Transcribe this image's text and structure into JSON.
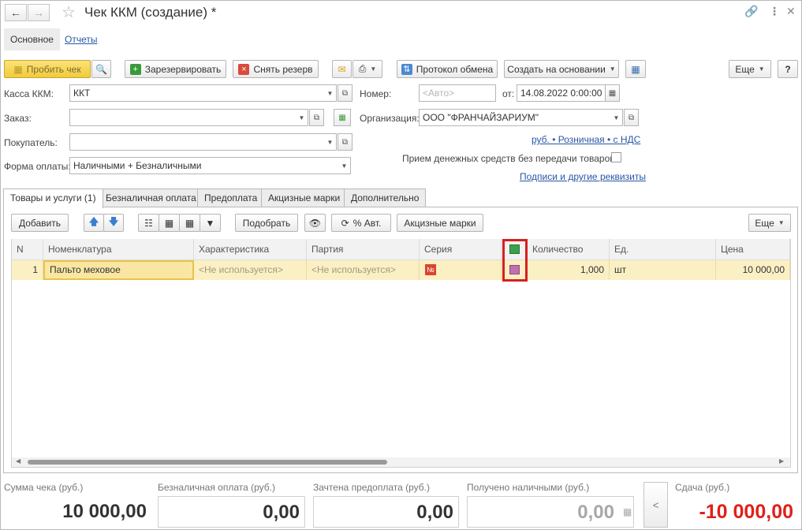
{
  "window": {
    "title": "Чек ККМ (создание) *"
  },
  "sections": {
    "main": "Основное",
    "reports": "Отчеты"
  },
  "toolbar": {
    "punch_receipt": "Пробить чек",
    "reserve": "Зарезервировать",
    "remove_reserve": "Снять резерв",
    "exchange_log": "Протокол обмена",
    "create_based_on": "Создать на основании",
    "more": "Еще",
    "help": "?"
  },
  "form": {
    "register_label": "Касса ККМ:",
    "register_value": "ККТ",
    "order_label": "Заказ:",
    "order_value": "",
    "buyer_label": "Покупатель:",
    "buyer_value": "",
    "payment_label": "Форма оплаты:",
    "payment_value": "Наличными + Безналичными",
    "number_label": "Номер:",
    "number_placeholder": "<Авто>",
    "date_label": "от:",
    "date_value": "14.08.2022  0:00:00",
    "org_label": "Организация:",
    "org_value": "ООО \"ФРАНЧАЙЗАРИУМ\"",
    "price_link": "руб. • Розничная • с НДС",
    "no_goods_label": "Прием денежных средств без передачи товаров:",
    "signatures_link": "Подписи и другие реквизиты"
  },
  "doc_tabs": [
    "Товары и услуги (1)",
    "Безналичная оплата",
    "Предоплата",
    "Акцизные марки",
    "Дополнительно"
  ],
  "table_toolbar": {
    "add": "Добавить",
    "pick": "Подобрать",
    "auto_percent": "% Авт.",
    "excise": "Акцизные марки",
    "more": "Еще"
  },
  "table": {
    "headers": [
      "N",
      "Номенклатура",
      "Характеристика",
      "Партия",
      "Серия",
      "",
      "Количество",
      "Ед.",
      "Цена"
    ],
    "rows": [
      {
        "n": "1",
        "item": "Пальто меховое",
        "characteristic": "<Не используется>",
        "batch": "<Не используется>",
        "series": "№",
        "quantity": "1,000",
        "unit": "шт",
        "price": "10 000,00"
      }
    ]
  },
  "footer": {
    "sum_label": "Сумма чека (руб.)",
    "sum_value": "10 000,00",
    "card_label": "Безналичная оплата (руб.)",
    "card_value": "0,00",
    "prepay_label": "Зачтена предоплата (руб.)",
    "prepay_value": "0,00",
    "cash_label": "Получено наличными (руб.)",
    "cash_value": "0,00",
    "collapse": "<",
    "change_label": "Сдача (руб.)",
    "change_value": "-10 000,00"
  },
  "colors": {
    "accent_yellow": "#f2cb39",
    "link_blue": "#2857a4",
    "row_highlight": "#fbefc4",
    "change_red": "#e0201a",
    "callout_red": "#d62020"
  }
}
